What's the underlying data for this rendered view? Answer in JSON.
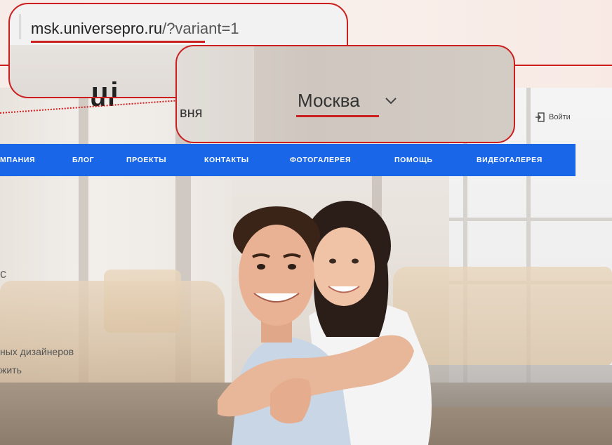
{
  "browser": {
    "url_domain": "msk.universepro.ru",
    "url_path": "/?variant=1"
  },
  "header": {
    "logo_fragment": "ui",
    "title_fragment": "вня",
    "city": "Москва",
    "login_label": "Войти"
  },
  "nav": {
    "items": [
      {
        "label": "МПАНИЯ"
      },
      {
        "label": "БЛОГ"
      },
      {
        "label": "ПРОЕКТЫ"
      },
      {
        "label": "КОНТАКТЫ"
      },
      {
        "label": "ФОТОГАЛЕРЕЯ"
      },
      {
        "label": "ПОМОЩЬ"
      },
      {
        "label": "ВИДЕОГАЛЕРЕЯ"
      }
    ]
  },
  "hero": {
    "mark": "с",
    "line1": "ных дизайнеров",
    "line2": "жить"
  },
  "colors": {
    "nav_bg": "#1a66e8",
    "callout_border": "#cc1f1f"
  },
  "icons": {
    "login": "login-arrow-icon",
    "city_dropdown": "chevron-down-icon"
  }
}
